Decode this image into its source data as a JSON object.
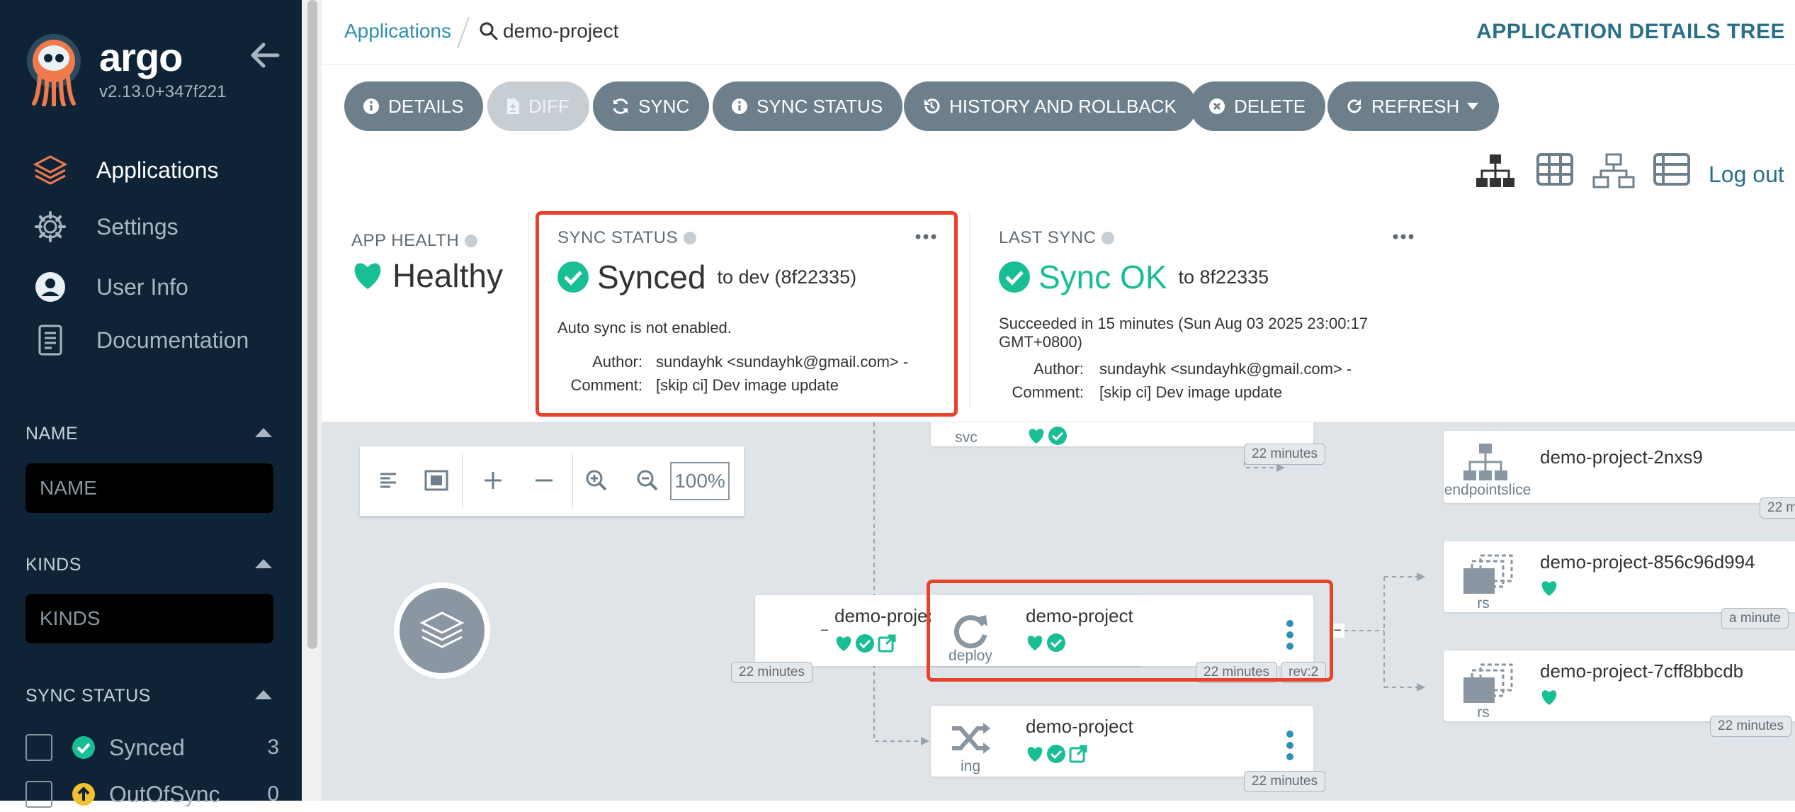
{
  "sidebar": {
    "brand": "argo",
    "version": "v2.13.0+347f221",
    "nav": [
      {
        "label": "Applications",
        "icon": "layers-icon",
        "active": true
      },
      {
        "label": "Settings",
        "icon": "gear-icon",
        "active": false
      },
      {
        "label": "User Info",
        "icon": "user-icon",
        "active": false
      },
      {
        "label": "Documentation",
        "icon": "book-icon",
        "active": false
      }
    ],
    "filters": {
      "name_title": "NAME",
      "name_placeholder": "NAME",
      "kinds_title": "KINDS",
      "kinds_placeholder": "KINDS",
      "sync_title": "SYNC STATUS",
      "sync_options": [
        {
          "label": "Synced",
          "count": "3",
          "color": "#18be94"
        },
        {
          "label": "OutOfSync",
          "count": "0",
          "color": "#f4c030"
        }
      ]
    }
  },
  "header": {
    "breadcrumb_root": "Applications",
    "breadcrumb_current": "demo-project",
    "title": "APPLICATION DETAILS TREE"
  },
  "toolbar": {
    "buttons": [
      {
        "label": "DETAILS",
        "icon": "info-icon",
        "disabled": false
      },
      {
        "label": "DIFF",
        "icon": "file-diff-icon",
        "disabled": true
      },
      {
        "label": "SYNC",
        "icon": "sync-icon",
        "disabled": false
      },
      {
        "label": "SYNC STATUS",
        "icon": "info-icon",
        "disabled": false
      },
      {
        "label": "HISTORY AND ROLLBACK",
        "icon": "history-icon",
        "disabled": false
      },
      {
        "label": "DELETE",
        "icon": "times-circle-icon",
        "disabled": false
      },
      {
        "label": "REFRESH",
        "icon": "redo-icon",
        "disabled": false
      }
    ],
    "logout": "Log out"
  },
  "status": {
    "app_health": {
      "label": "APP HEALTH",
      "value": "Healthy",
      "color": "#18be94"
    },
    "sync_status": {
      "label": "SYNC STATUS",
      "value": "Synced",
      "target": "to dev (8f22335)",
      "auto_sync": "Auto sync is not enabled.",
      "author_key": "Author:",
      "author": "sundayhk <sundayhk@gmail.com> -",
      "comment_key": "Comment:",
      "comment": "[skip ci] Dev image update"
    },
    "last_sync": {
      "label": "LAST SYNC",
      "value": "Sync OK",
      "target": "to 8f22335",
      "detail_line1": "Succeeded in 15 minutes (Sun Aug 03 2025 23:00:17",
      "detail_line2": "GMT+0800)",
      "author_key": "Author:",
      "author": "sundayhk <sundayhk@gmail.com> -",
      "comment_key": "Comment:",
      "comment": "[skip ci] Dev image update"
    }
  },
  "graph": {
    "zoom": "100%",
    "nodes": {
      "app": {
        "name": "demo-project",
        "time": "22 minutes"
      },
      "svc": {
        "kind": "svc",
        "time": "22 minutes"
      },
      "deploy": {
        "name": "demo-project",
        "kind": "deploy",
        "time": "22 minutes",
        "rev": "rev:2"
      },
      "ing": {
        "name": "demo-project",
        "kind": "ing",
        "time": "22 minutes"
      },
      "endpointslice": {
        "name": "demo-project-2nxs9",
        "kind": "endpointslice",
        "time": "22 m"
      },
      "rs1": {
        "name": "demo-project-856c96d994",
        "kind": "rs",
        "time": "a minute"
      },
      "rs2": {
        "name": "demo-project-7cff8bbcdb",
        "kind": "rs",
        "time": "22 minutes"
      }
    }
  },
  "colors": {
    "sidebar_bg": "#0e2436",
    "healthy": "#18be94",
    "accent": "#2d8fb2",
    "button": "#6d7f8b",
    "highlight": "#e8412c"
  }
}
